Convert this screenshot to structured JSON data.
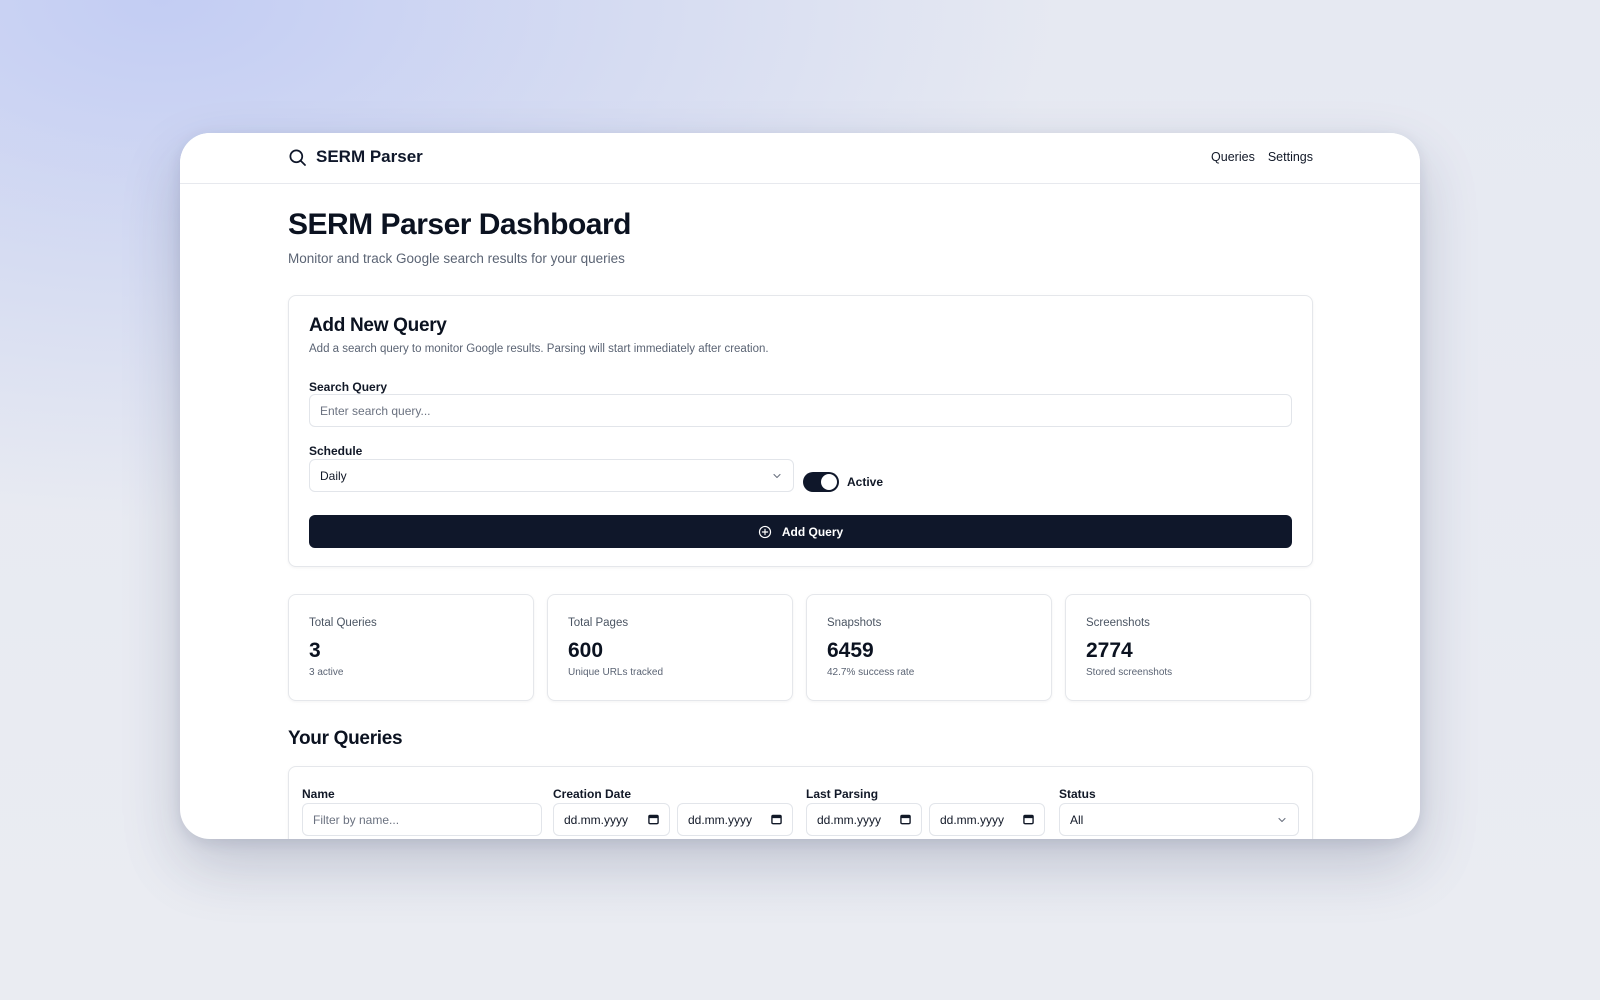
{
  "app": {
    "name": "SERM Parser",
    "logo_icon": "search-icon"
  },
  "nav": {
    "items": [
      {
        "label": "Queries"
      },
      {
        "label": "Settings"
      }
    ]
  },
  "page": {
    "title": "SERM Parser Dashboard",
    "subtitle": "Monitor and track Google search results for your queries"
  },
  "add_query": {
    "title": "Add New Query",
    "description": "Add a search query to monitor Google results. Parsing will start immediately after creation.",
    "search_label": "Search Query",
    "search_placeholder": "Enter search query...",
    "search_value": "",
    "schedule_label": "Schedule",
    "schedule_value": "Daily",
    "active_label": "Active",
    "active_on": true,
    "button_label": "Add Query",
    "button_icon": "plus-circle-icon"
  },
  "stats": [
    {
      "label": "Total Queries",
      "value": "3",
      "note": "3 active"
    },
    {
      "label": "Total Pages",
      "value": "600",
      "note": "Unique URLs tracked"
    },
    {
      "label": "Snapshots",
      "value": "6459",
      "note": "42.7% success rate"
    },
    {
      "label": "Screenshots",
      "value": "2774",
      "note": "Stored screenshots"
    }
  ],
  "queries": {
    "title": "Your Queries",
    "filters": {
      "name_label": "Name",
      "name_placeholder": "Filter by name...",
      "creation_label": "Creation Date",
      "creation_from": "dd.mm.yyyy",
      "creation_to": "dd.mm.yyyy",
      "last_label": "Last Parsing",
      "last_from": "dd.mm.yyyy",
      "last_to": "dd.mm.yyyy",
      "status_label": "Status",
      "status_value": "All"
    }
  },
  "colors": {
    "primary": "#0f172a",
    "border": "#e5e7eb",
    "muted": "#5b6474"
  }
}
